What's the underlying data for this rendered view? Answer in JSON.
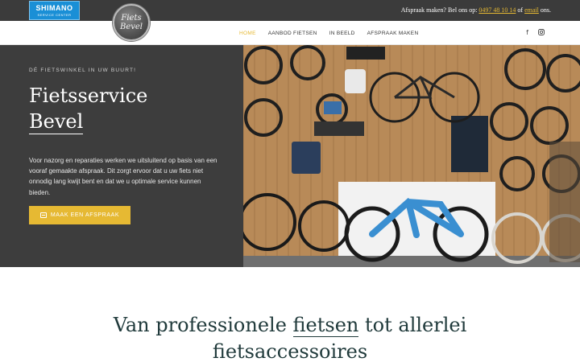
{
  "topbar": {
    "brand_line1": "SHIMANO",
    "brand_line2": "SERVICE CENTER",
    "contact_prefix": "Afspraak maken? Bel ons op:",
    "phone": "0497 48 10 14",
    "of": "of",
    "email": "email",
    "suffix": "ons."
  },
  "logo": {
    "line1": "Fiets",
    "line2": "Bevel"
  },
  "nav": {
    "items": [
      {
        "label": "HOME",
        "active": true
      },
      {
        "label": "AANBOD FIETSEN",
        "active": false
      },
      {
        "label": "IN BEELD",
        "active": false
      },
      {
        "label": "AFSPRAAK MAKEN",
        "active": false
      }
    ],
    "social": [
      "facebook-icon",
      "instagram-icon"
    ]
  },
  "hero": {
    "eyebrow": "Dé fietswinkel in uw buurt!",
    "title_line1": "Fietsservice",
    "title_line2": "Bevel",
    "text": "Voor nazorg en reparaties werken we uitsluitend op basis van een vooraf gemaakte afspraak. Dit zorgt ervoor dat u uw fiets niet onnodig lang kwijt bent en dat we u optimale service kunnen bieden.",
    "cta_label": "Maak een afspraak",
    "image_alt": "Bike shop interior"
  },
  "colors": {
    "accent": "#e6b933",
    "dark": "#3d3d3d",
    "heading": "#203a3b"
  },
  "section": {
    "title_part1": "Van professionele",
    "title_link": "fietsen",
    "title_part2": "tot allerlei",
    "title_line2": "fietsaccessoires"
  }
}
